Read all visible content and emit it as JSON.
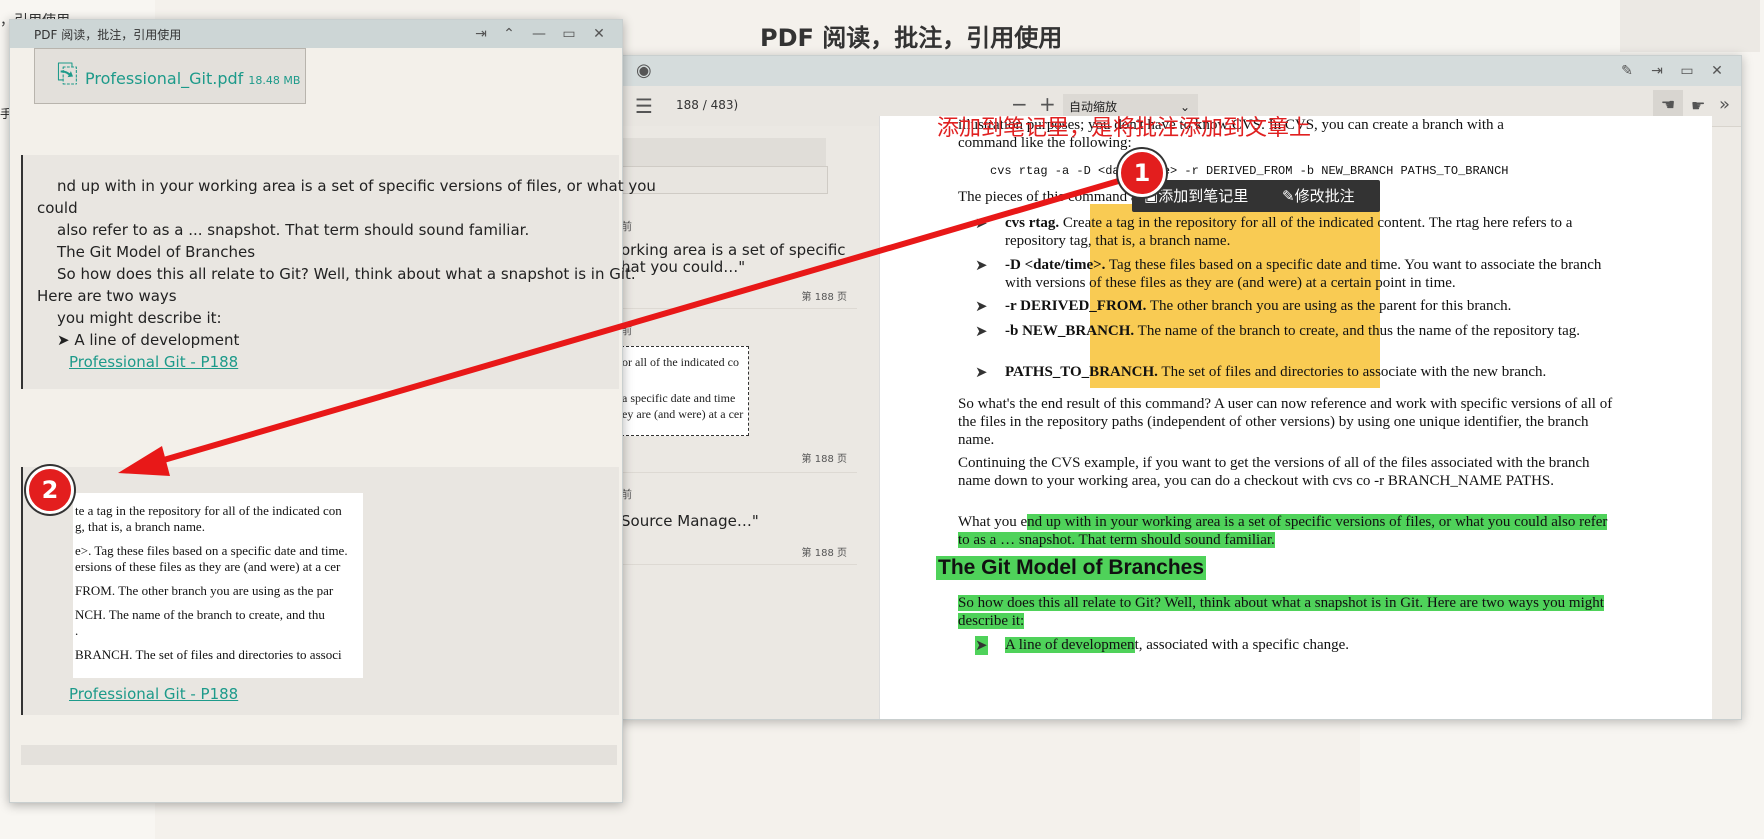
{
  "background": {
    "title": "PDF 阅读，批注，引用使用",
    "corner_text": "，引用使用",
    "edge_char": "手"
  },
  "pdf_window": {
    "page_count": "188 / 483)",
    "zoom": "自动缩放",
    "sidebar": {
      "cards": [
        {
          "meta": "前",
          "text": "orking area is a set of specific\nhat you could…\"",
          "page": "第 188 页"
        },
        {
          "meta": "前",
          "snapshot_lines": [
            "or all of the indicated co",
            "a specific date and time",
            "ey are (and were) at a cer"
          ],
          "page": "第 188 页"
        },
        {
          "meta": "前",
          "text": "Source Manage…\"",
          "page": "第 188 页"
        }
      ]
    },
    "page": {
      "line1": "illustration purposes; you don't have to know CVS. In CVS, you can create a branch with a",
      "line2": "command like the following:",
      "cmd": "cvs rtag -a -D <date/time> -r DERIVED_FROM -b NEW_BRANCH PATHS_TO_BRANCH",
      "pieces": "The pieces of this command are:",
      "items": [
        {
          "term": "cvs rtag.",
          "text": " Create a tag in the repository for all of the indicated content. The rtag here refers to a repository tag, that is, a branch name."
        },
        {
          "term": "-D <date/time>.",
          "text": " Tag these files based on a specific date and time. You want to associate the branch with versions of these files as they are (and were) at a certain point in time."
        },
        {
          "term": "-r DERIVED_FROM.",
          "text": " The other branch you are using as the parent for this branch."
        },
        {
          "term": "-b NEW_BRANCH.",
          "text": " The name of the branch to create, and thus the name of the repository tag."
        },
        {
          "term": "PATHS_TO_BRANCH.",
          "text": " The set of files and directories to associate with the new branch."
        }
      ],
      "para1": "So what's the end result of this command? A user can now reference and work with specific versions of all of the files in the repository paths (independent of other versions) by using one unique identifier, the branch name.",
      "para2": "Continuing the CVS example, if you want to get the versions of all of the files associated with the branch name down to your working area, you can do a checkout with cvs co -r BRANCH_NAME PATHS.",
      "para3_pre": "What you e",
      "para3_hl": "nd up with in your working area is a set of specific versions of files, or what you could also refer to as a … snapshot. That term should sound familiar.",
      "heading": "The Git Model of Branches",
      "para4": "So how does this all relate to Git? Well, think about what a snapshot is in Git. Here are two ways you might describe it:",
      "bullet_hl": "A line of developmen",
      "bullet_rest": "t, associated with a specific change."
    },
    "context_menu": {
      "add_note": "添加到笔记里",
      "edit_note": "修改批注"
    },
    "overlay_text": "添加到笔记里，是将批注添加到文章上"
  },
  "notes_window": {
    "title": "PDF 阅读，批注，引用使用",
    "attachment": {
      "name": "Professional_Git.pdf",
      "size": "18.48 MB"
    },
    "note1": {
      "lines": [
        "nd up with in your working area is a set of specific versions of files, or what you",
        "could",
        "also refer to as a ... snapshot. That term should sound familiar.",
        "The Git Model of Branches",
        "So how does this all relate to Git? Well, think about what a snapshot is in Git.",
        "Here are two ways",
        "you might describe it:",
        "➤ A line of development"
      ],
      "link": "Professional Git - P188"
    },
    "note2": {
      "snapshot_lines": [
        "te a tag in the repository for all of the indicated con",
        "g, that is, a branch name.",
        "e>. Tag these files based on a specific date and time.",
        "ersions of these files as they are (and were) at a cer",
        "FROM. The other branch you are using as the par",
        "NCH. The name of the branch to create, and thu",
        ".",
        "BRANCH. The set of files and directories to associ"
      ],
      "link": "Professional Git - P188"
    }
  },
  "markers": {
    "m1": "1",
    "m2": "2"
  },
  "colors": {
    "highlight_yellow": "#f8c235",
    "highlight_green": "#4fd25a",
    "link": "#1d9a8a",
    "arrow": "#e81818"
  }
}
